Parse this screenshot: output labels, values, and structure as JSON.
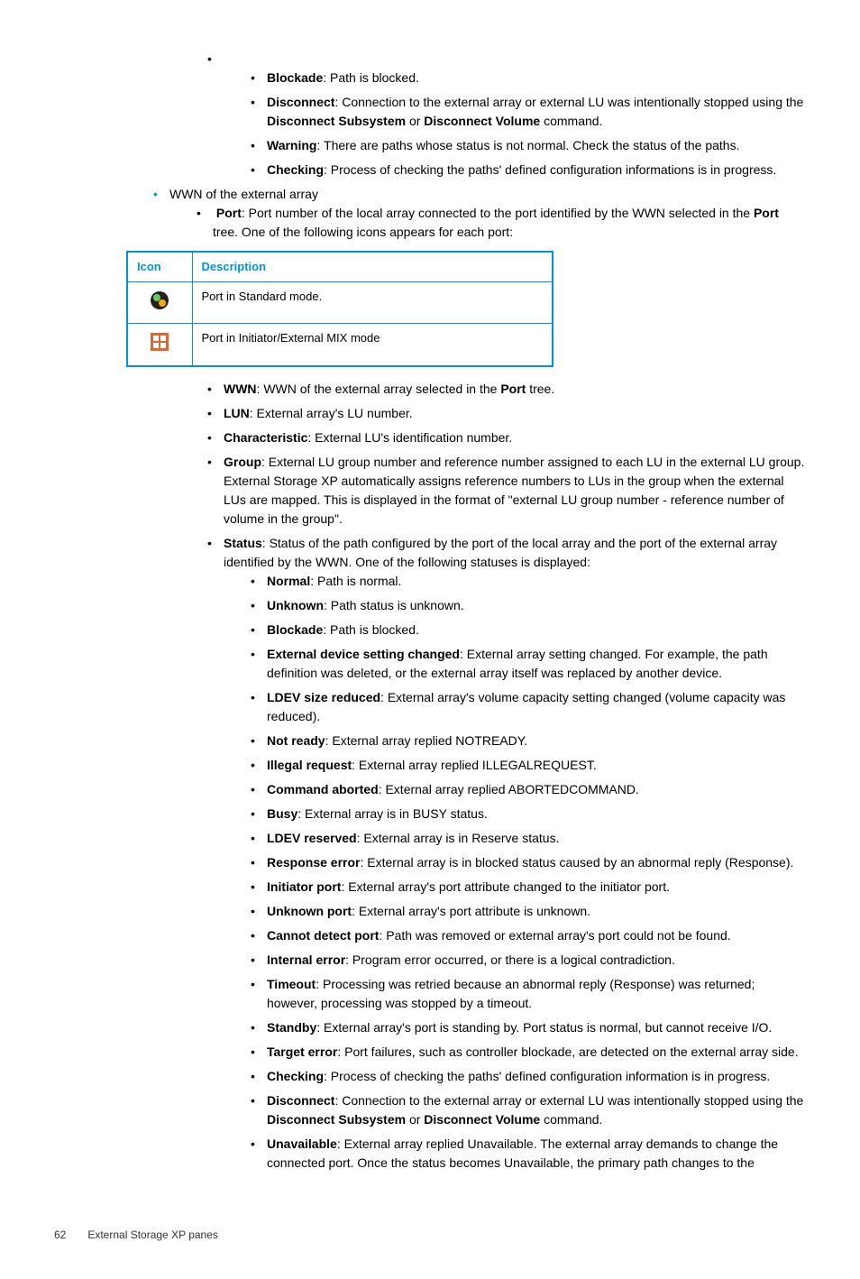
{
  "l3a": [
    {
      "b": "Blockade",
      "t": ": Path is blocked."
    },
    {
      "b": "Disconnect",
      "t": ": Connection to the external array or external LU was intentionally stopped using the ",
      "b2": "Disconnect Subsystem",
      "t2": " or ",
      "b3": "Disconnect Volume",
      "t3": " command."
    },
    {
      "b": "Warning",
      "t": ": There are paths whose status is not normal. Check the status of the paths."
    },
    {
      "b": "Checking",
      "t": ": Process of checking the paths' defined configuration informations is in progress."
    }
  ],
  "wwn_line": "WWN of the external array",
  "port_item": {
    "b": "Port",
    "t": ": Port number of the local array connected to the port identified by the WWN selected in the ",
    "b2": "Port",
    "t2": " tree. One of the following icons appears for each port:"
  },
  "table": {
    "h1": "Icon",
    "h2": "Description",
    "r1": "Port in Standard mode.",
    "r2": "Port in Initiator/External MIX mode"
  },
  "after_table": [
    {
      "b": "WWN",
      "t": ": WWN of the external array selected in the ",
      "b2": "Port",
      "t2": " tree."
    },
    {
      "b": "LUN",
      "t": ": External array's LU number."
    },
    {
      "b": "Characteristic",
      "t": ": External LU's identification number."
    },
    {
      "b": "Group",
      "t": ": External LU group number and reference number assigned to each LU in the external LU group. External Storage XP automatically assigns reference numbers to LUs in the group when the external LUs are mapped. This is displayed in the format of \"external LU group number - reference number of volume in the group\"."
    },
    {
      "b": "Status",
      "t": ": Status of the path configured by the port of the local array and the port of the external array identified by the WWN. One of the following statuses is displayed:"
    }
  ],
  "statuses": [
    {
      "b": "Normal",
      "t": ": Path is normal."
    },
    {
      "b": "Unknown",
      "t": ": Path status is unknown."
    },
    {
      "b": "Blockade",
      "t": ": Path is blocked."
    },
    {
      "b": "External device setting changed",
      "t": ": External array setting changed. For example, the path definition was deleted, or the external array itself was replaced by another device."
    },
    {
      "b": "LDEV size reduced",
      "t": ": External array's volume capacity setting changed (volume capacity was reduced)."
    },
    {
      "b": "Not ready",
      "t": ": External array replied NOTREADY."
    },
    {
      "b": "Illegal request",
      "t": ": External array replied ILLEGALREQUEST."
    },
    {
      "b": "Command aborted",
      "t": ": External array replied ABORTEDCOMMAND."
    },
    {
      "b": "Busy",
      "t": ": External array is in BUSY status."
    },
    {
      "b": "LDEV reserved",
      "t": ": External array is in Reserve status."
    },
    {
      "b": "Response error",
      "t": ": External array is in blocked status caused by an abnormal reply (Response)."
    },
    {
      "b": "Initiator port",
      "t": ": External array's port attribute changed to the initiator port."
    },
    {
      "b": "Unknown port",
      "t": ": External array's port attribute is unknown."
    },
    {
      "b": "Cannot detect port",
      "t": ": Path was removed or external array's port could not be found."
    },
    {
      "b": "Internal error",
      "t": ": Program error occurred, or there is a logical contradiction."
    },
    {
      "b": "Timeout",
      "t": ": Processing was retried because an abnormal reply (Response) was returned; however, processing was stopped by a timeout."
    },
    {
      "b": "Standby",
      "t": ": External array's port is standing by. Port status is normal, but cannot receive I/O."
    },
    {
      "b": "Target error",
      "t": ": Port failures, such as controller blockade, are detected on the external array side."
    },
    {
      "b": "Checking",
      "t": ": Process of checking the paths' defined configuration information is in progress."
    },
    {
      "b": "Disconnect",
      "t": ": Connection to the external array or external LU was intentionally stopped using the ",
      "b2": "Disconnect Subsystem",
      "t2": " or ",
      "b3": "Disconnect Volume",
      "t3": " command."
    },
    {
      "b": "Unavailable",
      "t": ": External array replied Unavailable. The external array demands to change the connected port. Once the status becomes Unavailable, the primary path changes to the"
    }
  ],
  "footer": {
    "page": "62",
    "section": "External Storage XP panes"
  }
}
